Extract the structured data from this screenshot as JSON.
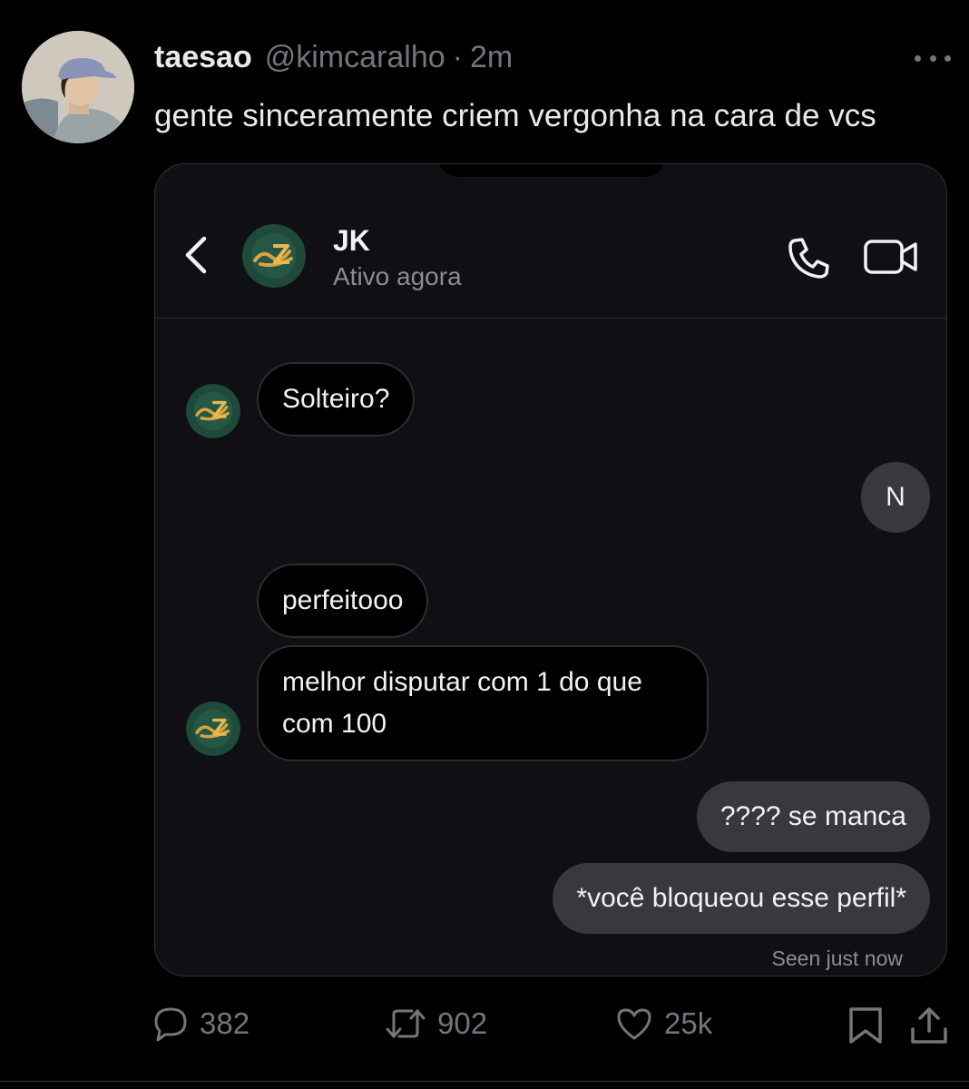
{
  "tweet": {
    "display_name": "taesao",
    "handle": "@kimcaralho",
    "separator": "·",
    "time": "2m",
    "text": "gente sinceramente criem vergonha na cara de vcs"
  },
  "chat": {
    "contact_name": "JK",
    "contact_status": "Ativo agora",
    "messages": [
      {
        "direction": "in",
        "text": "Solteiro?"
      },
      {
        "direction": "out",
        "text": "N"
      },
      {
        "direction": "in",
        "text": "perfeitooo"
      },
      {
        "direction": "in",
        "text": "melhor disputar com 1 do que com 100"
      },
      {
        "direction": "out",
        "text": "???? se manca"
      },
      {
        "direction": "out",
        "text": "*você bloqueou esse perfil*"
      }
    ],
    "seen_label": "Seen just now"
  },
  "actions": {
    "reply_count": "382",
    "retweet_count": "902",
    "like_count": "25k"
  },
  "icons": {
    "back": "chevron-left-icon",
    "call": "phone-icon",
    "video": "video-camera-icon",
    "more": "more-horizontal-icon",
    "reply": "reply-icon",
    "retweet": "retweet-icon",
    "like": "heart-icon",
    "bookmark": "bookmark-icon",
    "share": "share-icon"
  },
  "colors": {
    "background": "#000000",
    "chat_background": "#0f0f14",
    "outgoing_bubble": "#38393e",
    "muted_text": "#71767b"
  }
}
